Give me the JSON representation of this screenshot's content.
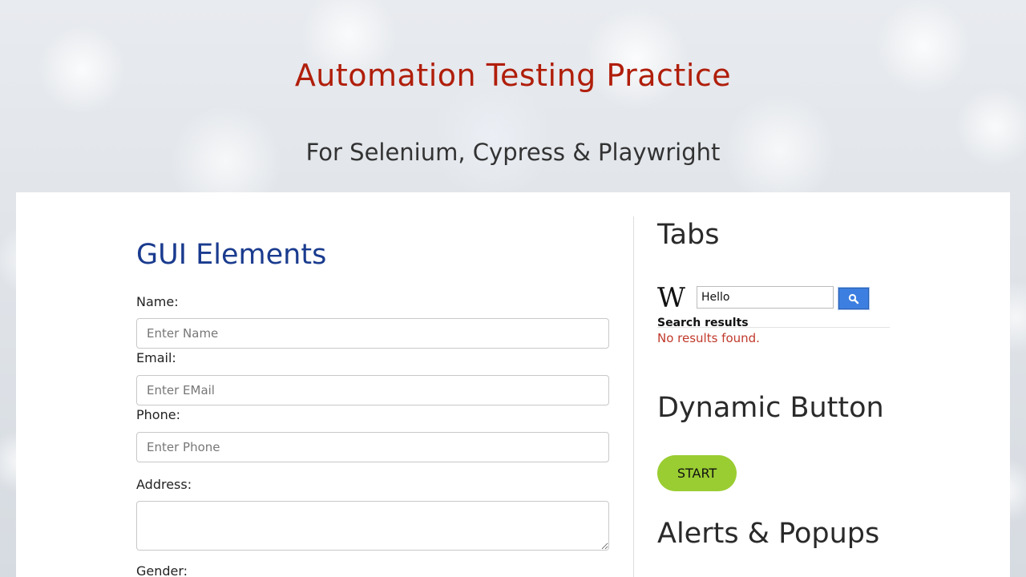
{
  "header": {
    "title": "Automation Testing Practice",
    "subtitle": "For Selenium, Cypress & Playwright"
  },
  "gui_elements": {
    "heading": "GUI Elements",
    "name_label": "Name:",
    "name_placeholder": "Enter Name",
    "email_label": "Email:",
    "email_placeholder": "Enter EMail",
    "phone_label": "Phone:",
    "phone_placeholder": "Enter Phone",
    "address_label": "Address:",
    "gender_label": "Gender:"
  },
  "tabs": {
    "heading": "Tabs",
    "wiki_logo": "W",
    "search_value": "Hello",
    "search_results_label": "Search results",
    "no_results_text": "No results found."
  },
  "dynamic_button": {
    "heading": "Dynamic Button",
    "start_label": "START"
  },
  "alerts": {
    "heading": "Alerts & Popups"
  },
  "colors": {
    "title_red": "#b01e0a",
    "heading_blue": "#1a3b8e",
    "start_green": "#9acd32",
    "search_blue": "#3d7fe0",
    "no_results_red": "#c0392b"
  }
}
